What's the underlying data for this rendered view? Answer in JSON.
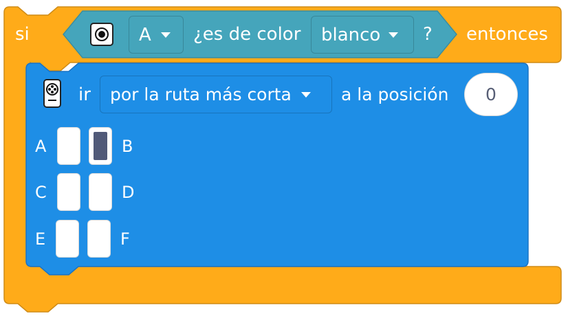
{
  "if_block": {
    "if_label": "si",
    "then_label": "entonces",
    "color": "#ffab19"
  },
  "condition": {
    "icon": "color-sensor-icon",
    "port_value": "A",
    "question_label": "¿es de color",
    "color_value": "blanco",
    "question_mark": "?",
    "color": "#45a5bb"
  },
  "motor_block": {
    "icon": "motor-icon",
    "go_label": "ir",
    "direction_value": "por la ruta más corta",
    "position_label": "a la posición",
    "position_value": "0",
    "color": "#1e8ee6"
  },
  "ports": {
    "labels": [
      "A",
      "B",
      "C",
      "D",
      "E",
      "F"
    ],
    "selected": [
      "B"
    ]
  }
}
